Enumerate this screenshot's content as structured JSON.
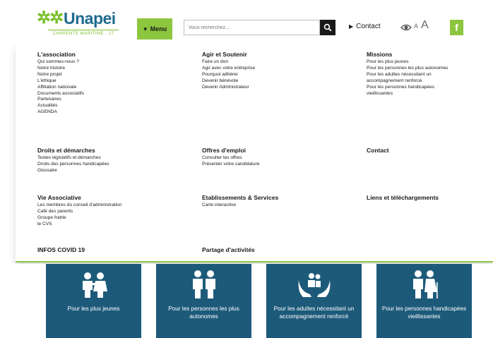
{
  "header": {
    "logo": {
      "mark": "✲✲",
      "name": "Unapei",
      "sub": "CHARENTE MARITIME · 17"
    },
    "menu_label": "Menu",
    "search_placeholder": "Vous recherchez...",
    "contact_label": "Contact",
    "font_small": "A",
    "font_large": "A",
    "facebook": "f",
    "accent_color": "#8cc63f",
    "brand_color": "#1e6b8f"
  },
  "menu": {
    "association": {
      "title": "L'association",
      "items": [
        "Qui sommes-nous ?",
        "Notre histoire",
        "Notre projet",
        "L'éthique",
        "Affiliation nationale",
        "Documents associatifs",
        "Partenaires",
        "Actualités",
        "AGENDA"
      ]
    },
    "agir": {
      "title": "Agir et Soutenir",
      "items": [
        "Faire un don",
        "Agir avec votre entreprise",
        "Pourquoi adhérer",
        "Devenir bénévole",
        "Devenir Administrateur"
      ]
    },
    "missions": {
      "title": "Missions",
      "items": [
        "Pour les plus jeunes",
        "Pour les personnes les plus autonomes",
        "Pour les adultes nécessitant un",
        "accompagnement renforcé",
        "Pour les personnes handicapées",
        "vieillissantes"
      ]
    },
    "droits": {
      "title": "Droits et démarches",
      "items": [
        "Textes législatifs et démarches",
        "Droits des personnes handicapées",
        "Glossaire"
      ]
    },
    "offres": {
      "title": "Offres d'emploi",
      "items": [
        "Consulter les offres",
        "Présenter votre candidature"
      ]
    },
    "contact": {
      "title": "Contact"
    },
    "vie": {
      "title": "Vie Associative",
      "items": [
        "Les membres du conseil d'administration",
        "Café des parents",
        "Groupe fratrie",
        "le CVS"
      ]
    },
    "etablissements": {
      "title": "Etablissements & Services",
      "items": [
        "Carte interactive"
      ]
    },
    "liens": {
      "title": "Liens et téléchargements"
    },
    "covid": {
      "title": "INFOS COVID 19"
    },
    "partage": {
      "title": "Partage d'activités"
    }
  },
  "cards": [
    {
      "label": "Pour les plus jeunes",
      "icon": "children-icon"
    },
    {
      "label": "Pour les personnes les plus autonomes",
      "icon": "adults-icon"
    },
    {
      "label": "Pour les adultes nécessitant un accompagnement renforcé",
      "icon": "care-hands-icon"
    },
    {
      "label": "Pour les personnes handicapées vieillissantes",
      "icon": "seniors-icon"
    }
  ],
  "card_color": "#1d5a7a"
}
